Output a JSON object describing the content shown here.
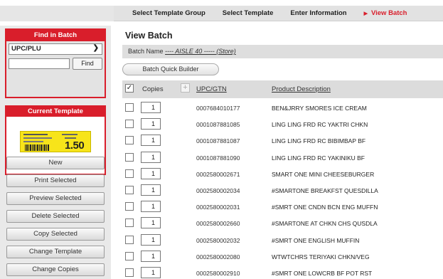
{
  "nav": {
    "steps": [
      {
        "label": "Select Template Group"
      },
      {
        "label": "Select Template"
      },
      {
        "label": "Enter Information"
      },
      {
        "label": "View Batch",
        "active": true
      }
    ]
  },
  "sidebar": {
    "find_title": "Find in Batch",
    "find_field": "UPC/PLU",
    "find_input_value": "",
    "find_button": "Find",
    "template_title": "Current Template",
    "template_price": "1.50",
    "buttons": [
      "New",
      "Print Selected",
      "Preview Selected",
      "Delete Selected",
      "Copy Selected",
      "Change Template",
      "Change Copies"
    ]
  },
  "main": {
    "title": "View Batch",
    "batch_label": "Batch Name",
    "batch_name": "---- AISLE 40 ----- (Store)",
    "quick_builder": "Batch Quick Builder",
    "columns": {
      "copies": "Copies",
      "upc": "UPC/GTN",
      "desc": "Product Description"
    },
    "rows": [
      {
        "copies": "1",
        "upc": "0007684010177",
        "desc": "BEN&JRRY SMORES ICE CREAM"
      },
      {
        "copies": "1",
        "upc": "0001087881085",
        "desc": "LING LING FRD RC YAKTRI CHKN"
      },
      {
        "copies": "1",
        "upc": "0001087881087",
        "desc": "LING LING FRD RC BIBIMBAP BF"
      },
      {
        "copies": "1",
        "upc": "0001087881090",
        "desc": "LING LING FRD RC YAKINIKU BF"
      },
      {
        "copies": "1",
        "upc": "0002580002671",
        "desc": "SMART ONE MINI CHEESEBURGER"
      },
      {
        "copies": "1",
        "upc": "0002580002034",
        "desc": "#SMARTONE BREAKFST QUESDILLA"
      },
      {
        "copies": "1",
        "upc": "0002580002031",
        "desc": "#SMRT ONE CNDN BCN ENG MUFFN"
      },
      {
        "copies": "1",
        "upc": "0002580002660",
        "desc": "#SMARTONE AT CHKN CHS QUSDLA"
      },
      {
        "copies": "1",
        "upc": "0002580002032",
        "desc": "#SMRT ONE ENGLISH MUFFIN"
      },
      {
        "copies": "1",
        "upc": "0002580002080",
        "desc": "WTWTCHRS TERIYAKI CHKN/VEG"
      },
      {
        "copies": "1",
        "upc": "0002580002910",
        "desc": "#SMRT ONE LOWCRB BF POT RST"
      }
    ]
  },
  "colors": {
    "accent": "#d91e2b",
    "tag": "#f7e41a"
  }
}
